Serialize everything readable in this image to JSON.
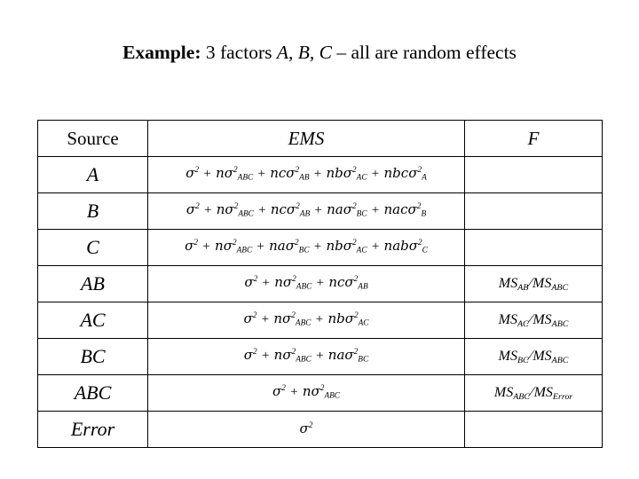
{
  "title": {
    "bold_prefix": "Example:",
    "rest_1": " 3 factors ",
    "factors": "A, B, C",
    "rest_2": " – all are random effects"
  },
  "table": {
    "headers": {
      "source": "Source",
      "ems": "EMS",
      "f": "F"
    },
    "rows": [
      {
        "source": "A",
        "ems_text": "σ² + nσ²ABC + ncσ²AB + nbσ²AC + nbcσ²A",
        "ems_terms": [
          {
            "coef": "",
            "sym": "σ",
            "sup": "2",
            "sub": ""
          },
          {
            "coef": "n",
            "sym": "σ",
            "sup": "2",
            "sub": "ABC"
          },
          {
            "coef": "nc",
            "sym": "σ",
            "sup": "2",
            "sub": "AB"
          },
          {
            "coef": "nb",
            "sym": "σ",
            "sup": "2",
            "sub": "AC"
          },
          {
            "coef": "nbc",
            "sym": "σ",
            "sup": "2",
            "sub": "A"
          }
        ],
        "f_text": "",
        "f_num": "",
        "f_den": ""
      },
      {
        "source": "B",
        "ems_text": "σ² + nσ²ABC + ncσ²AB + naσ²BC + nacσ²B",
        "ems_terms": [
          {
            "coef": "",
            "sym": "σ",
            "sup": "2",
            "sub": ""
          },
          {
            "coef": "n",
            "sym": "σ",
            "sup": "2",
            "sub": "ABC"
          },
          {
            "coef": "nc",
            "sym": "σ",
            "sup": "2",
            "sub": "AB"
          },
          {
            "coef": "na",
            "sym": "σ",
            "sup": "2",
            "sub": "BC"
          },
          {
            "coef": "nac",
            "sym": "σ",
            "sup": "2",
            "sub": "B"
          }
        ],
        "f_text": "",
        "f_num": "",
        "f_den": ""
      },
      {
        "source": "C",
        "ems_text": "σ² + nσ²ABC + naσ²BC + nbσ²AC + nabσ²C",
        "ems_terms": [
          {
            "coef": "",
            "sym": "σ",
            "sup": "2",
            "sub": ""
          },
          {
            "coef": "n",
            "sym": "σ",
            "sup": "2",
            "sub": "ABC"
          },
          {
            "coef": "na",
            "sym": "σ",
            "sup": "2",
            "sub": "BC"
          },
          {
            "coef": "nb",
            "sym": "σ",
            "sup": "2",
            "sub": "AC"
          },
          {
            "coef": "nab",
            "sym": "σ",
            "sup": "2",
            "sub": "C"
          }
        ],
        "f_text": "",
        "f_num": "",
        "f_den": ""
      },
      {
        "source": "AB",
        "ems_text": "σ² + nσ²ABC + ncσ²AB",
        "ems_terms": [
          {
            "coef": "",
            "sym": "σ",
            "sup": "2",
            "sub": ""
          },
          {
            "coef": "n",
            "sym": "σ",
            "sup": "2",
            "sub": "ABC"
          },
          {
            "coef": "nc",
            "sym": "σ",
            "sup": "2",
            "sub": "AB"
          }
        ],
        "f_text": "MSAB / MSABC",
        "f_num": "AB",
        "f_den": "ABC"
      },
      {
        "source": "AC",
        "ems_text": "σ² + nσ²ABC + nbσ²AC",
        "ems_terms": [
          {
            "coef": "",
            "sym": "σ",
            "sup": "2",
            "sub": ""
          },
          {
            "coef": "n",
            "sym": "σ",
            "sup": "2",
            "sub": "ABC"
          },
          {
            "coef": "nb",
            "sym": "σ",
            "sup": "2",
            "sub": "AC"
          }
        ],
        "f_text": "MSAC / MSABC",
        "f_num": "AC",
        "f_den": "ABC"
      },
      {
        "source": "BC",
        "ems_text": "σ² + nσ²ABC + naσ²BC",
        "ems_terms": [
          {
            "coef": "",
            "sym": "σ",
            "sup": "2",
            "sub": ""
          },
          {
            "coef": "n",
            "sym": "σ",
            "sup": "2",
            "sub": "ABC"
          },
          {
            "coef": "na",
            "sym": "σ",
            "sup": "2",
            "sub": "BC"
          }
        ],
        "f_text": "MSBC / MSABC",
        "f_num": "BC",
        "f_den": "ABC"
      },
      {
        "source": "ABC",
        "ems_text": "σ² + nσ²ABC",
        "ems_terms": [
          {
            "coef": "",
            "sym": "σ",
            "sup": "2",
            "sub": ""
          },
          {
            "coef": "n",
            "sym": "σ",
            "sup": "2",
            "sub": "ABC"
          }
        ],
        "f_text": "MSABC / MSError",
        "f_num": "ABC",
        "f_den": "Error"
      },
      {
        "source": "Error",
        "ems_text": "σ²",
        "ems_terms": [
          {
            "coef": "",
            "sym": "σ",
            "sup": "2",
            "sub": ""
          }
        ],
        "f_text": "",
        "f_num": "",
        "f_den": ""
      }
    ],
    "f_prefix": "MS"
  }
}
